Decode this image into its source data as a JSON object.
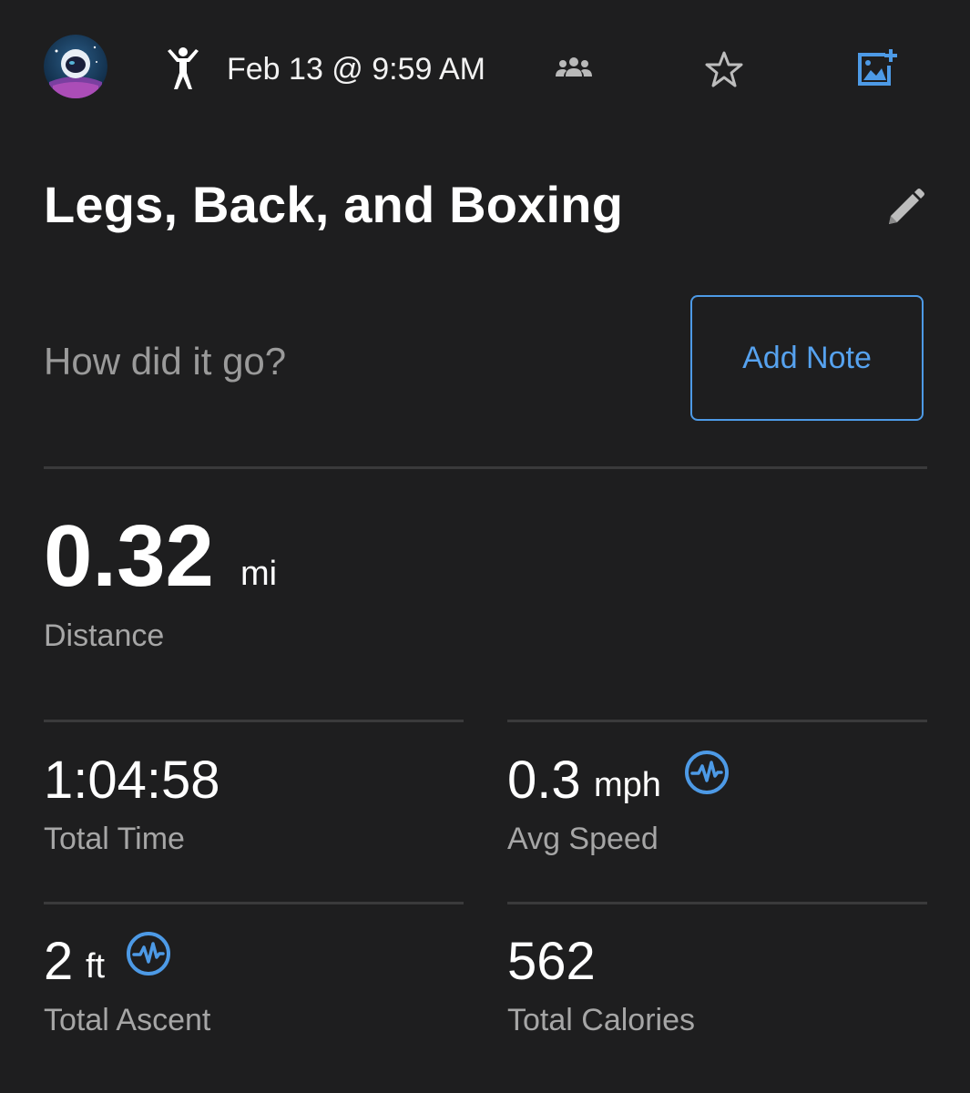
{
  "header": {
    "date": "Feb 13 @ 9:59 AM",
    "icons": {
      "avatar": "astronaut-avatar",
      "activity": "strength-training-icon",
      "people": "group-icon",
      "favorite": "star-icon",
      "add_media": "add-photo-icon"
    }
  },
  "activity": {
    "title": "Legs, Back, and Boxing",
    "edit_icon": "pencil-icon"
  },
  "note": {
    "prompt": "How did it go?",
    "button_label": "Add Note"
  },
  "distance": {
    "value": "0.32",
    "unit": "mi",
    "label": "Distance"
  },
  "stats": [
    {
      "value": "1:04:58",
      "unit": "",
      "label": "Total Time",
      "icon": ""
    },
    {
      "value": "0.3",
      "unit": "mph",
      "label": "Avg Speed",
      "icon": "metric-pulse-icon"
    },
    {
      "value": "2",
      "unit": "ft",
      "label": "Total Ascent",
      "icon": "metric-pulse-icon"
    },
    {
      "value": "562",
      "unit": "",
      "label": "Total Calories",
      "icon": ""
    }
  ],
  "colors": {
    "background": "#1e1e1f",
    "accent": "#4d9ae6",
    "divider": "#3a3a3b",
    "secondary_text": "#a6a6a6"
  }
}
